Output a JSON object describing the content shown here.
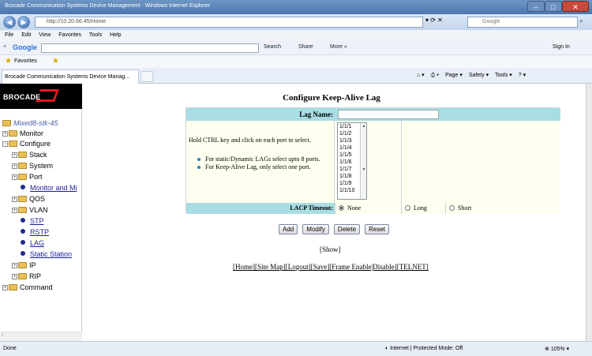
{
  "window": {
    "title": "Brocade Communication Systems Device Management - Windows Internet Explorer",
    "min": "–",
    "max": "□",
    "close": "✕"
  },
  "address": {
    "url": "http://10.20.66.45/Home",
    "search_placeholder": "Google"
  },
  "menu": [
    "File",
    "Edit",
    "View",
    "Favorites",
    "Tools",
    "Help"
  ],
  "google_toolbar": {
    "close": "×",
    "logo": "Google",
    "search": "Search",
    "share": "Share",
    "more": "More »",
    "sign_in": "Sign In"
  },
  "favorites": {
    "label": "Favorites"
  },
  "tab": {
    "label": "Brocade Communication Systems Device Manag..."
  },
  "command_bar": [
    "Page ▾",
    "Safety ▾",
    "Tools ▾"
  ],
  "sidebar": {
    "logo": "BROCADE",
    "root": "Mixed8-stk-45",
    "items": {
      "monitor": "Monitor",
      "configure": "Configure",
      "stack": "Stack",
      "system": "System",
      "port": "Port",
      "monitor_and_mi": "Monitor and Mi",
      "qos": "QOS",
      "vlan": "VLAN",
      "stp": "STP",
      "rstp": "RSTP",
      "lag": "LAG",
      "static_station": "Static Station",
      "ip": "IP",
      "rip": "RIP",
      "command": "Command"
    }
  },
  "form": {
    "title": "Configure Keep-Alive Lag",
    "lag_name_label": "Lag Name:",
    "lag_name_value": "",
    "hold_text": "Hold CTRL key and click on each port to select.",
    "rule1": "For static/Dynamic LAGs select upto 8 ports.",
    "rule2": "For Keep-Alive Lag, only select one port.",
    "ports": [
      "1/1/1",
      "1/1/2",
      "1/1/3",
      "1/1/4",
      "1/1/5",
      "1/1/6",
      "1/1/7",
      "1/1/8",
      "1/1/9",
      "1/1/10"
    ],
    "lacp_label": "LACP Timeout:",
    "lacp_none": "None",
    "lacp_long": "Long",
    "lacp_short": "Short"
  },
  "buttons": {
    "add": "Add",
    "modify": "Modify",
    "delete": "Delete",
    "reset": "Reset"
  },
  "show": "[Show]",
  "footer_links": [
    "[Home]",
    "[Site Map]",
    "[Logout]",
    "[Save]",
    "[Frame Enable|Disable]",
    "[TELNET]"
  ],
  "status": {
    "done": "Done",
    "zone": "Internet | Protected Mode: Off",
    "zoom": "105%"
  }
}
